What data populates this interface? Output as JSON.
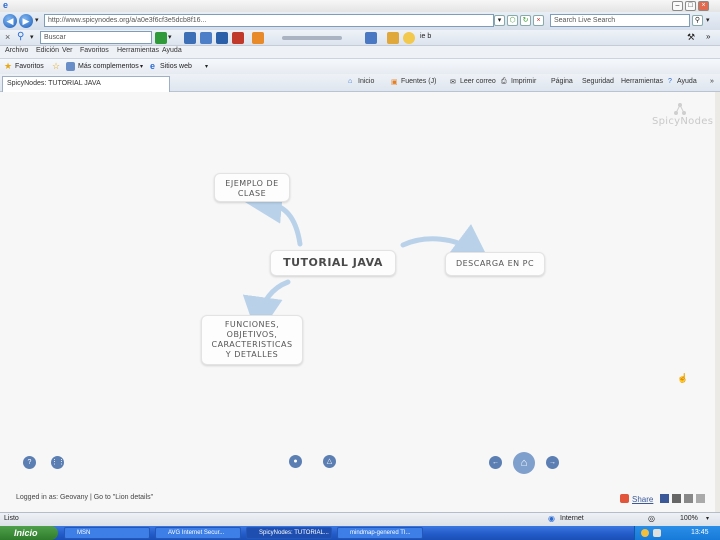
{
  "browser": {
    "address_url": "http://www.spicynodes.org/a/a0e3f6cf3e5dcb8f16...",
    "search_placeholder": "Search Live Search",
    "toolbar_search_value": "Buscar",
    "toolbar_ie_label": "ie b",
    "menu": [
      "Archivo",
      "Edición",
      "Ver",
      "Favoritos",
      "Herramientas",
      "Ayuda"
    ],
    "favorites_label": "Favoritos",
    "favorites_links": [
      "Más complementos",
      "Sitios web"
    ],
    "tab_title": "SpicyNodes: TUTORIAL JAVA",
    "commands": [
      "Inicio",
      "Fuentes (J)",
      "Leer correo",
      "Imprimir",
      "Página",
      "Seguridad",
      "Herramientas",
      "Ayuda"
    ]
  },
  "app": {
    "logo": "SpicyNodes",
    "nodes": {
      "center": "TUTORIAL JAVA",
      "top": "EJEMPLO DE CLASE",
      "right": "DESCARGA EN PC",
      "bottom": "FUNCIONES, OBJETIVOS, CARACTERISTICAS Y DETALLES"
    },
    "footer_text": "Logged in as: Geovany | Go to \"Lion details\"",
    "share_label": "Share",
    "buttons": {
      "help": "?",
      "grid": "⋮⋮",
      "search": "●",
      "home_small": "△",
      "prev": "←",
      "home": "⌂",
      "next": "→"
    }
  },
  "statusbar": {
    "left": "Listo",
    "zone": "Internet",
    "zoom": "100%"
  },
  "taskbar": {
    "start": "Inicio",
    "items": [
      "MSN",
      "AVG Internet Secur...",
      "SpicyNodes: TUTORIAL...",
      "mindmap-genered TI..."
    ],
    "clock": "13:45"
  },
  "colors": {
    "content_bg": "#f7f7f7",
    "accent": "#5b7fb3",
    "arrow": "#b9d2ea"
  }
}
